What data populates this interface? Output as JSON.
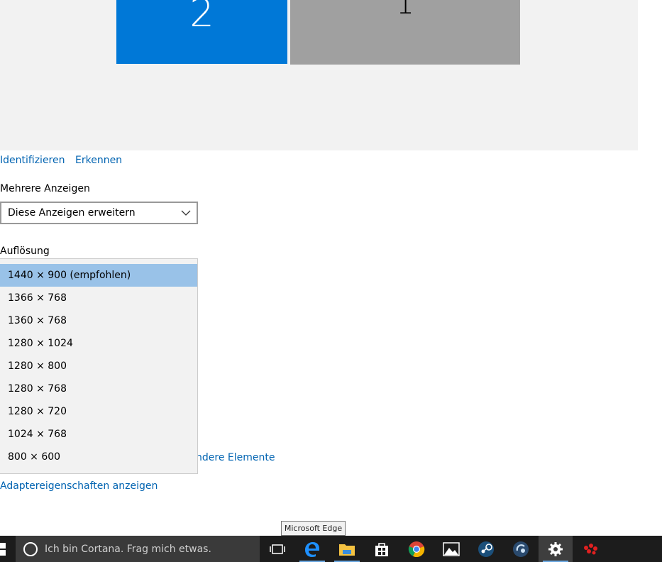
{
  "monitors": {
    "monitor2_label": "2",
    "monitor1_label": "1"
  },
  "links": {
    "identify": "Identifizieren",
    "detect": "Erkennen",
    "other_elements": "ndere Elemente",
    "adapter_properties": "Adaptereigenschaften anzeigen"
  },
  "multiple_displays": {
    "label": "Mehrere Anzeigen",
    "selected": "Diese Anzeigen erweitern"
  },
  "resolution": {
    "label": "Auflösung",
    "options": [
      "1440 × 900 (empfohlen)",
      "1366 × 768",
      "1360 × 768",
      "1280 × 1024",
      "1280 × 800",
      "1280 × 768",
      "1280 × 720",
      "1024 × 768",
      "800 × 600"
    ]
  },
  "tooltip": "Microsoft Edge",
  "taskbar": {
    "search_placeholder": "Ich bin Cortana. Frag mich etwas.",
    "icons": [
      "task-view-icon",
      "edge-icon",
      "file-explorer-icon",
      "store-icon",
      "chrome-icon",
      "photos-icon",
      "steam-icon",
      "teamspeak-icon",
      "settings-icon",
      "app-icon"
    ]
  },
  "colors": {
    "accent": "#0078d7",
    "link": "#0063b1",
    "selected_option": "#99c2e8",
    "taskbar": "#1c1c1c"
  }
}
